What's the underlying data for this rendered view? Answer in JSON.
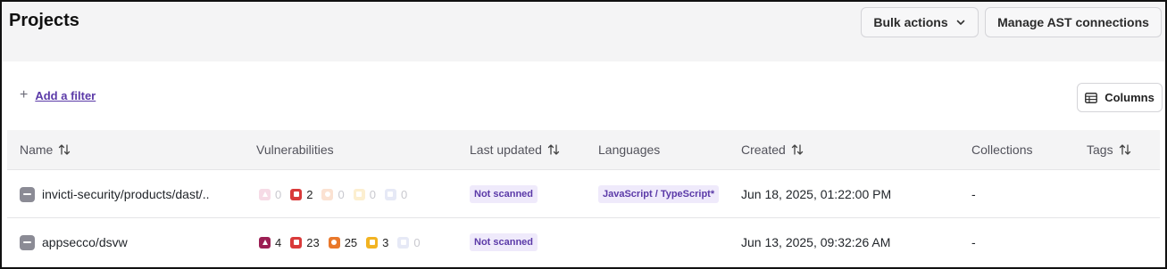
{
  "header": {
    "title": "Projects",
    "bulk_actions_label": "Bulk actions",
    "manage_ast_label": "Manage AST connections"
  },
  "toolbar": {
    "add_filter_label": "Add a filter",
    "columns_label": "Columns"
  },
  "table": {
    "columns": [
      "Name",
      "Vulnerabilities",
      "Last updated",
      "Languages",
      "Created",
      "Collections",
      "Tags"
    ],
    "rows": [
      {
        "name": "invicti-security/products/dast/..",
        "vulns": {
          "critical": "0",
          "high": "2",
          "medium": "0",
          "low": "0",
          "info": "0"
        },
        "last_updated": "Not scanned",
        "language": "JavaScript / TypeScript*",
        "created": "Jun 18, 2025, 01:22:00 PM",
        "collections": "-"
      },
      {
        "name": "appsecco/dsvw",
        "vulns": {
          "critical": "4",
          "high": "23",
          "medium": "25",
          "low": "3",
          "info": "0"
        },
        "last_updated": "Not scanned",
        "language": "",
        "created": "Jun 13, 2025, 09:32:26 AM",
        "collections": "-"
      }
    ]
  },
  "colors": {
    "critical": "#9c1f54",
    "high": "#d93a3a",
    "medium": "#e9782b",
    "low": "#f2b321",
    "info": "#c7cce8",
    "accent": "#5b3aa8"
  },
  "icons": {
    "filter": "plus-icon",
    "columns": "table-icon",
    "sort": "sort-arrows-icon",
    "row_select": "minus-checkbox-icon",
    "dropdown": "chevron-down-icon"
  }
}
